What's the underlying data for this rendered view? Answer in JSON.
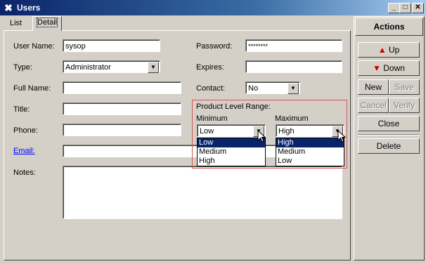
{
  "window": {
    "title": "Users"
  },
  "tabs": [
    {
      "label": "List"
    },
    {
      "label": "Detail"
    }
  ],
  "form": {
    "user_name": {
      "label": "User Name:",
      "value": "sysop"
    },
    "type": {
      "label": "Type:",
      "value": "Administrator"
    },
    "full_name": {
      "label": "Full Name:",
      "value": ""
    },
    "title": {
      "label": "Title:",
      "value": ""
    },
    "phone": {
      "label": "Phone:",
      "value": ""
    },
    "email": {
      "label": "Email:",
      "value": ""
    },
    "notes": {
      "label": "Notes:",
      "value": ""
    },
    "password": {
      "label": "Password:",
      "value": "********"
    },
    "expires": {
      "label": "Expires:",
      "value": ""
    },
    "contact": {
      "label": "Contact:",
      "value": "No"
    }
  },
  "product_level_range": {
    "label": "Product Level Range:",
    "minimum": {
      "label": "Minimum",
      "value": "Low",
      "options": [
        "Low",
        "Medium",
        "High"
      ]
    },
    "maximum": {
      "label": "Maximum",
      "value": "High",
      "options": [
        "High",
        "Medium",
        "Low"
      ]
    }
  },
  "actions": {
    "header": "Actions",
    "buttons": [
      {
        "label": "Up",
        "enabled": true
      },
      {
        "label": "Down",
        "enabled": true
      },
      {
        "label": "New",
        "enabled": true
      },
      {
        "label": "Save",
        "enabled": false
      },
      {
        "label": "Cancel",
        "enabled": false
      },
      {
        "label": "Verify",
        "enabled": false
      },
      {
        "label": "Close",
        "enabled": true
      },
      {
        "label": "Delete",
        "enabled": true
      }
    ]
  },
  "colors": {
    "titlebar": "#0a246a",
    "highlight": "#0a246a",
    "panel": "#d4d0c8",
    "up_arrow": "#cc0000",
    "down_arrow": "#cc0000",
    "group_border": "#d9534f"
  }
}
